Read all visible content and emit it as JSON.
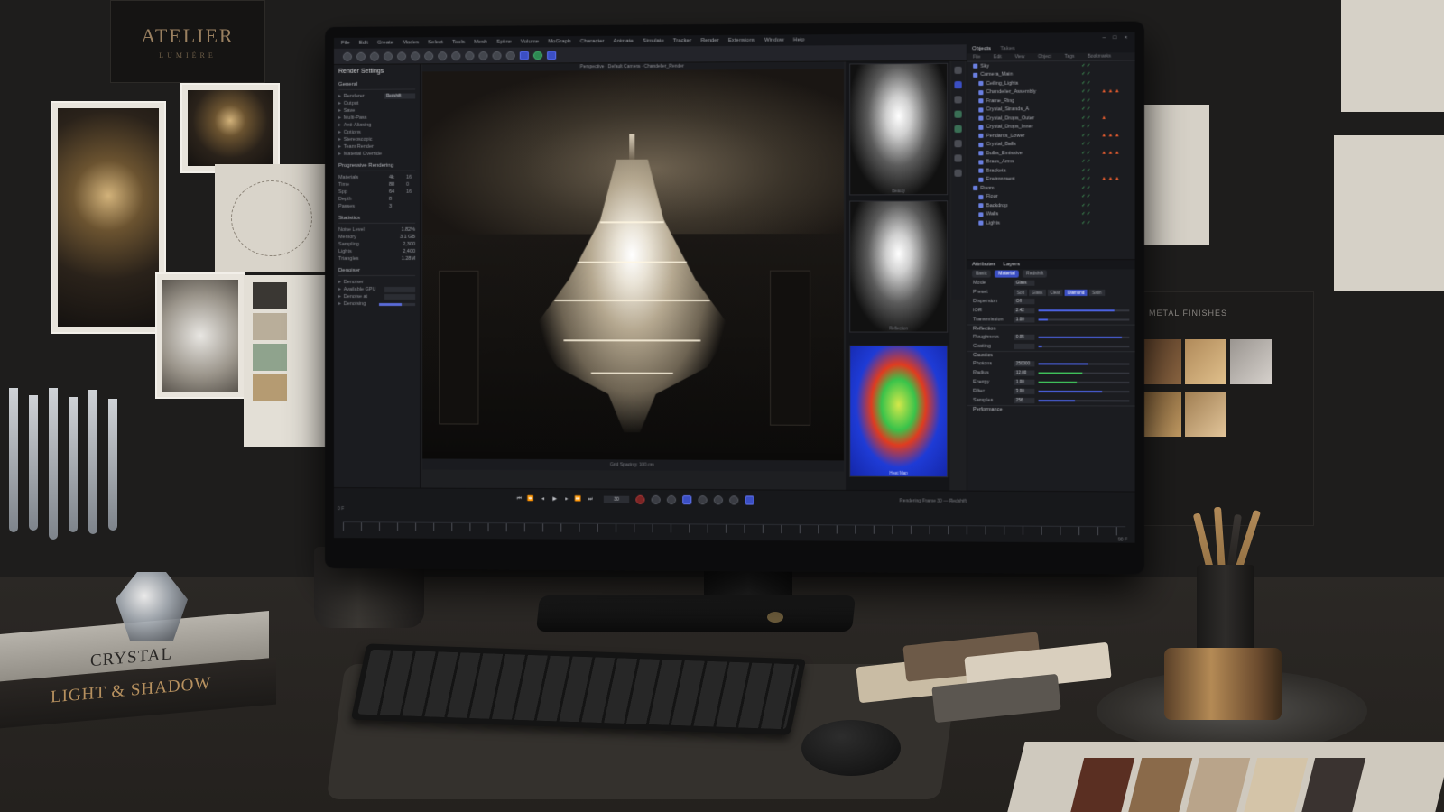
{
  "room": {
    "studio_card": {
      "name": "ATELIER",
      "subtitle": "LUMIÈRE"
    },
    "metal_card_label": "METAL FINISHES",
    "books": {
      "top": "CRYSTAL",
      "bottom": "LIGHT & SHADOW"
    }
  },
  "colors": {
    "accent_blue": "#3b4fc4",
    "accent_green": "#3fbf5a",
    "warning": "#e25b2f",
    "brass": "#b48a55"
  },
  "app": {
    "menus": [
      "File",
      "Edit",
      "Create",
      "Modes",
      "Select",
      "Tools",
      "Mesh",
      "Spline",
      "Volume",
      "MoGraph",
      "Character",
      "Animate",
      "Simulate",
      "Tracker",
      "Render",
      "Extensions",
      "Window",
      "Help"
    ],
    "window_controls": [
      "–",
      "□",
      "×"
    ],
    "toolbar_icons": [
      "undo-icon",
      "redo-icon",
      "select-icon",
      "move-icon",
      "scale-icon",
      "rotate-icon",
      "cube-icon",
      "sphere-icon",
      "spline-icon",
      "nurbs-icon",
      "deformer-icon",
      "light-icon",
      "camera-icon",
      "render-icon",
      "render-region-icon",
      "render-view-icon"
    ]
  },
  "render_settings": {
    "title": "Render Settings",
    "general_label": "General",
    "renderer_label": "Renderer",
    "renderer_value": "Redshift",
    "items": [
      "Output",
      "Save",
      "Multi-Pass",
      "Anti-Aliasing",
      "Options",
      "Stereoscopic",
      "Team Render",
      "Material Override"
    ],
    "progressive": {
      "title": "Progressive Rendering",
      "rows": [
        {
          "label": "Materials",
          "a": "4k",
          "b": "16"
        },
        {
          "label": "Time",
          "a": "88",
          "b": "0"
        },
        {
          "label": "Spp",
          "a": "64",
          "b": "16"
        },
        {
          "label": "Depth",
          "a": "8",
          "b": ""
        },
        {
          "label": "Passes",
          "a": "3",
          "b": ""
        }
      ]
    },
    "statistics": {
      "title": "Statistics",
      "rows": [
        {
          "label": "Noise Level",
          "value": "1.82%"
        },
        {
          "label": "Memory",
          "value": "3.1 GB"
        },
        {
          "label": "Sampling",
          "value": "2,300"
        },
        {
          "label": "Lights",
          "value": "2,400"
        },
        {
          "label": "Triangles",
          "value": "1.28M"
        }
      ]
    },
    "denoiser": {
      "title": "Denoiser",
      "rows": [
        "Denoiser",
        "Available GPU",
        "Denoise at",
        "Denoising"
      ],
      "progress": 0.62
    }
  },
  "viewport": {
    "header": "Perspective · Default Camera · Chandelier_Render",
    "footer": "Grid Spacing: 100 cm"
  },
  "thumbnails": [
    {
      "caption": "Beauty"
    },
    {
      "caption": "Reflection"
    },
    {
      "caption": "Heat Map"
    }
  ],
  "objects": {
    "tabs": [
      "Objects",
      "Takes"
    ],
    "columns": [
      "File",
      "Edit",
      "View",
      "Object",
      "Tags",
      "Bookmarks"
    ],
    "rows": [
      {
        "name": "Sky",
        "warn": ""
      },
      {
        "name": "Camera_Main",
        "warn": ""
      },
      {
        "name": "Ceiling_Lights",
        "warn": ""
      },
      {
        "name": "Chandelier_Assembly",
        "warn": "▲▲▲"
      },
      {
        "name": "Frame_Ring",
        "warn": ""
      },
      {
        "name": "Crystal_Strands_A",
        "warn": ""
      },
      {
        "name": "Crystal_Drops_Outer",
        "warn": "▲"
      },
      {
        "name": "Crystal_Drops_Inner",
        "warn": ""
      },
      {
        "name": "Pendants_Lower",
        "warn": "▲▲▲"
      },
      {
        "name": "Crystal_Balls",
        "warn": ""
      },
      {
        "name": "Bulbs_Emissive",
        "warn": "▲▲▲"
      },
      {
        "name": "Brass_Arms",
        "warn": ""
      },
      {
        "name": "Brackets",
        "warn": ""
      },
      {
        "name": "Environment",
        "warn": "▲▲▲"
      },
      {
        "name": "Room",
        "warn": ""
      },
      {
        "name": "Floor",
        "warn": ""
      },
      {
        "name": "Backdrop",
        "warn": ""
      },
      {
        "name": "Walls",
        "warn": ""
      },
      {
        "name": "Lights",
        "warn": ""
      }
    ]
  },
  "attributes": {
    "tabs": [
      "Attributes",
      "Layers"
    ],
    "subtabs": [
      {
        "label": "Basic",
        "on": false
      },
      {
        "label": "Material",
        "on": true
      },
      {
        "label": "Redshift",
        "on": false
      }
    ],
    "rows": [
      {
        "label": "Mode",
        "box": "Glass"
      },
      {
        "label": "Preset",
        "seg": [
          "Soft",
          "Glass",
          "Clear",
          "Diamond",
          "Satin"
        ],
        "seg_on": 3
      },
      {
        "label": "Dispersion",
        "box": "Off"
      },
      {
        "label": "IOR",
        "box": "2.42",
        "track": 0.84
      },
      {
        "label": "Transmission",
        "box": "1.00",
        "track": 0.1
      }
    ],
    "section2": "Reflection",
    "rows2": [
      {
        "label": "Roughness",
        "box": "0.05",
        "track": 0.92
      },
      {
        "label": "Coating",
        "box": "",
        "track": 0.04
      }
    ],
    "section3": "Caustics",
    "rows3": [
      {
        "label": "Photons",
        "box": "250000",
        "track": 0.55,
        "green": false
      },
      {
        "label": "Radius",
        "box": "12.00",
        "track": 0.48,
        "green": true
      },
      {
        "label": "Energy",
        "box": "1.00",
        "track": 0.42,
        "green": true
      },
      {
        "label": "Filter",
        "box": "3.00",
        "track": 0.7,
        "green": false
      },
      {
        "label": "Samples",
        "box": "256",
        "track": 0.4,
        "green": false
      }
    ],
    "section4": "Performance"
  },
  "timeline": {
    "frame": "30",
    "start": "0 F",
    "status": "Rendering Frame 30 — Redshift",
    "end": "90 F"
  }
}
